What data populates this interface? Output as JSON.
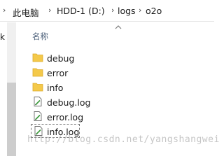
{
  "address_bar": {
    "crumbs": [
      "此电脑",
      "HDD-1 (D:)",
      "logs",
      "o2o"
    ]
  },
  "left_pane": {
    "visible_text": "k"
  },
  "file_list": {
    "column_header": "名称",
    "items": [
      {
        "name": "debug",
        "type": "folder"
      },
      {
        "name": "error",
        "type": "folder"
      },
      {
        "name": "info",
        "type": "folder"
      },
      {
        "name": "debug.log",
        "type": "file"
      },
      {
        "name": "error.log",
        "type": "file"
      },
      {
        "name": "info.log",
        "type": "file",
        "selected": true
      }
    ]
  },
  "watermark": "http://blog.csdn.net/yangshangwei",
  "colors": {
    "folder": "#f4c94a",
    "folder_dark": "#dcaa2a",
    "header_text": "#4c607a"
  }
}
